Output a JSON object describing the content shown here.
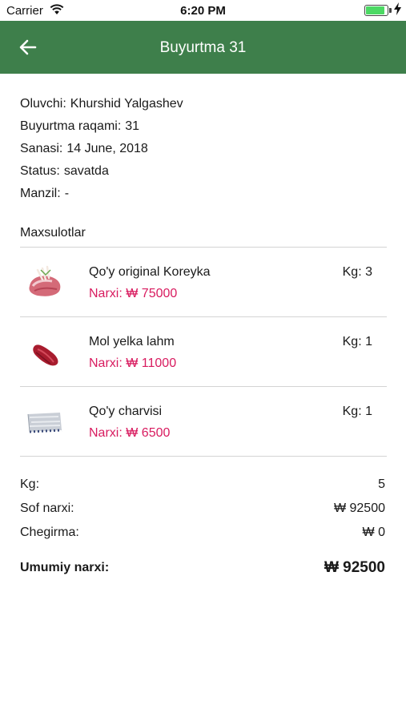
{
  "status_bar": {
    "carrier": "Carrier",
    "time": "6:20 PM",
    "battery_level": 0.9
  },
  "header": {
    "title": "Buyurtma 31",
    "back_icon": "arrow-left-icon"
  },
  "order_info": {
    "recipient_label": "Oluvchi:",
    "recipient": "Khurshid Yalgashev",
    "number_label": "Buyurtma raqami:",
    "number": "31",
    "date_label": "Sanasi:",
    "date": "14 June, 2018",
    "status_label": "Status:",
    "status": "savatda",
    "address_label": "Manzil:",
    "address": "-"
  },
  "products_title": "Maxsulotlar",
  "products": [
    {
      "name": "Qo'y original Koreyka",
      "qty_label": "Kg:",
      "qty": "3",
      "price_label": "Narxi:",
      "currency": "₩",
      "price": "75000",
      "image": "lamb-ribs-thumbnail"
    },
    {
      "name": "Mol yelka lahm",
      "qty_label": "Kg:",
      "qty": "1",
      "price_label": "Narxi:",
      "currency": "₩",
      "price": "11000",
      "image": "beef-shoulder-thumbnail"
    },
    {
      "name": "Qo'y charvisi",
      "qty_label": "Kg:",
      "qty": "1",
      "price_label": "Narxi:",
      "currency": "₩",
      "price": "6500",
      "image": "lamb-fat-thumbnail"
    }
  ],
  "totals": {
    "kg_label": "Kg:",
    "kg": "5",
    "net_label": "Sof narxi:",
    "net": "₩  92500",
    "discount_label": "Chegirma:",
    "discount": "₩  0",
    "total_label": "Umumiy narxi:",
    "total": "₩ 92500"
  },
  "colors": {
    "header": "#3e7f4b",
    "price": "#d81b5f",
    "divider": "#d4d4d4"
  }
}
